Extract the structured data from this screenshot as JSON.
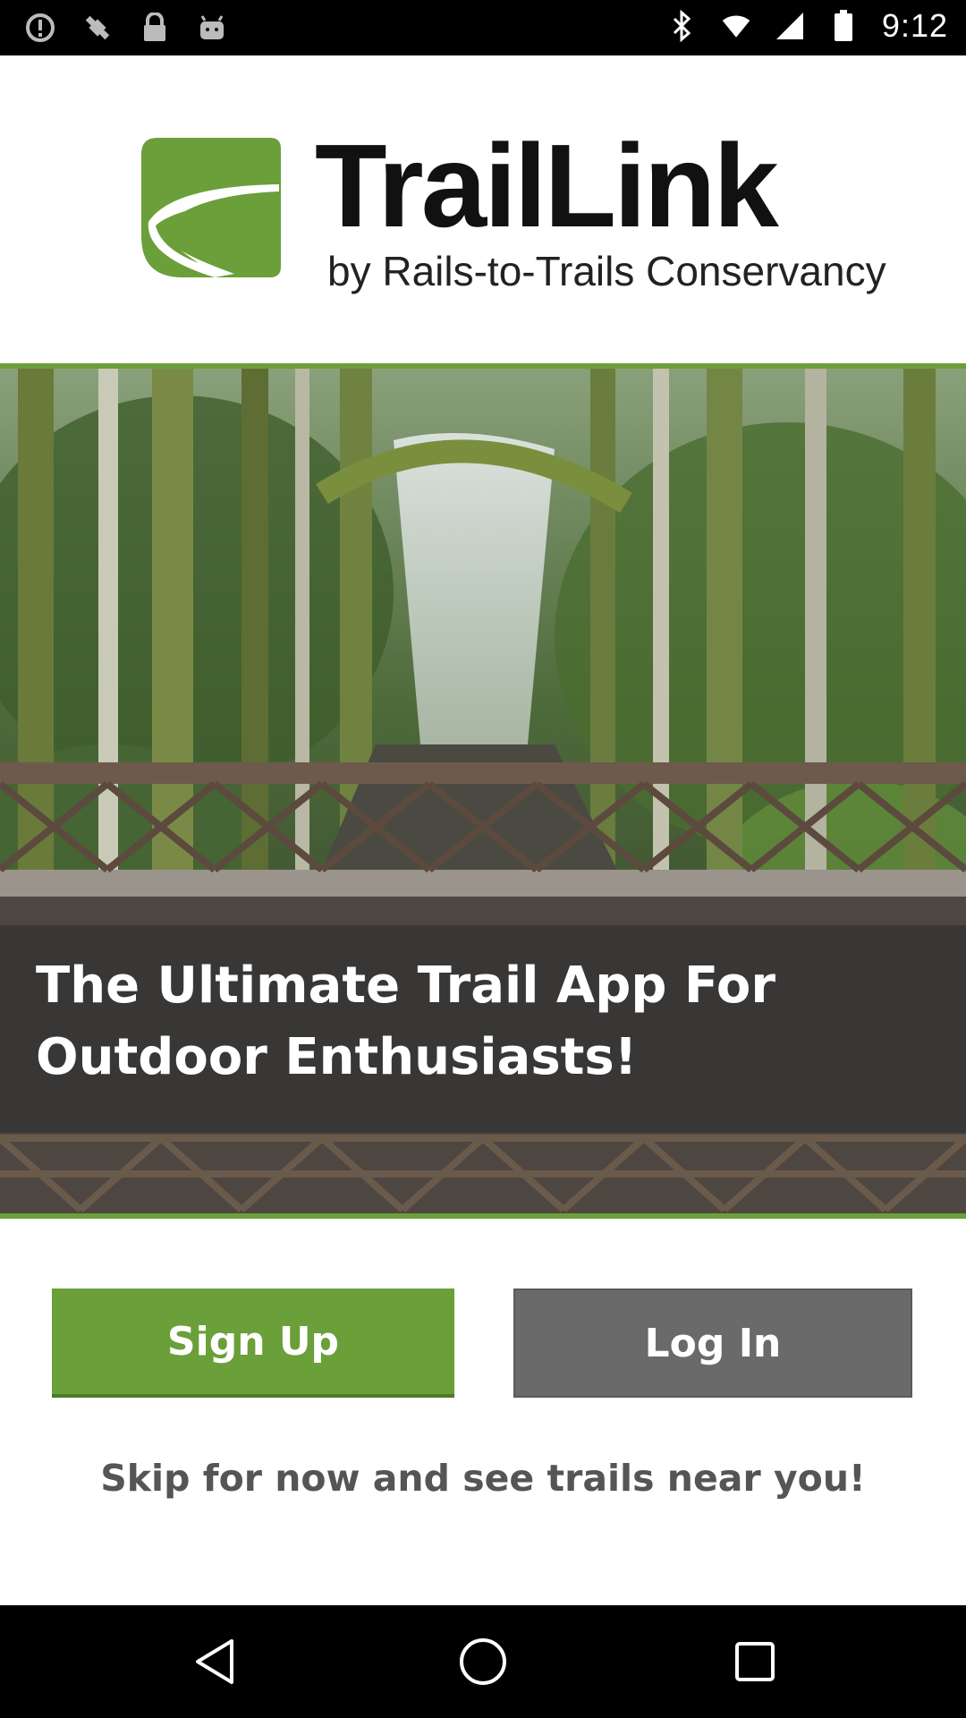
{
  "status_bar": {
    "time": "9:12",
    "left_icons": [
      "alert-icon",
      "fake-gps-icon",
      "lock-icon",
      "android-icon"
    ],
    "right_icons": [
      "bluetooth-icon",
      "wifi-icon",
      "signal-icon",
      "battery-icon"
    ]
  },
  "brand": {
    "name": "TrailLink",
    "tagline_sub": "by Rails-to-Trails Conservancy",
    "logo_icon": "trail-road-icon",
    "logo_color": "#6b9f3a"
  },
  "hero": {
    "headline": "The Ultimate Trail App For Outdoor Enthusiasts!",
    "image_description_icon": "forest-bridge-photo"
  },
  "actions": {
    "signup_label": "Sign Up",
    "login_label": "Log In",
    "skip_label": "Skip for now and see trails near you!"
  },
  "colors": {
    "accent_green": "#6b9f3a",
    "login_gray": "#6a6a6a",
    "text_gray": "#555555"
  },
  "nav_bar": {
    "buttons": [
      "back-icon",
      "home-icon",
      "recents-icon"
    ]
  }
}
